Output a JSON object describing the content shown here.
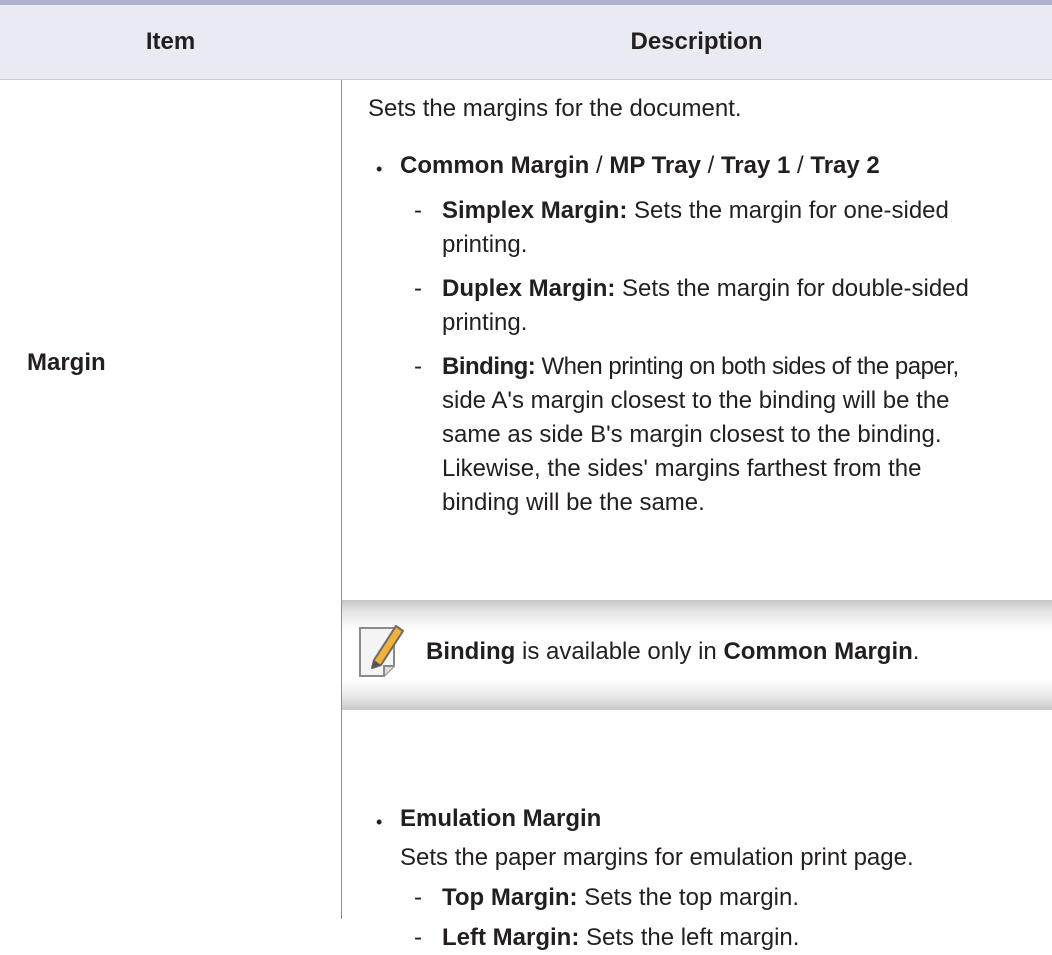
{
  "table": {
    "headers": {
      "item": "Item",
      "description": "Description"
    },
    "row": {
      "item": "Margin",
      "intro": "Sets the margins for the document.",
      "bullet1": {
        "common_margin": "Common Margin",
        "sep1": " / ",
        "mp_tray": "MP Tray",
        "sep2": " / ",
        "tray1": "Tray 1",
        "sep3": " / ",
        "tray2": "Tray 2"
      },
      "simplex": {
        "label": "Simplex Margin:",
        "line1": " Sets the margin for one-sided",
        "line2": "printing."
      },
      "duplex": {
        "label": "Duplex Margin:",
        "line1": " Sets the margin for double-sided",
        "line2": "printing."
      },
      "binding": {
        "label": "Binding:",
        "line1": " When printing on both sides of the paper,",
        "line2": "side A's margin closest to the binding will be the",
        "line3": "same as side B's margin closest to the binding.",
        "line4": "Likewise, the sides' margins farthest from the",
        "line5": "binding will be the same."
      },
      "note": {
        "binding": "Binding",
        "text": " is available only in ",
        "common_margin": "Common Margin",
        "period": "."
      },
      "emulation": {
        "title": "Emulation Margin",
        "desc": "Sets the paper margins for emulation print page.",
        "top": {
          "label": "Top Margin:",
          "text": " Sets the top margin."
        },
        "left": {
          "label": "Left Margin:",
          "text": " Sets the left margin."
        }
      },
      "bullet_char": "•",
      "dash_char": "-"
    }
  },
  "colors": {
    "header_bg": "#eaeaf3",
    "top_rule": "#b0b1d1",
    "text": "#231f20",
    "note_pencil": "#f2b233"
  },
  "icons": {
    "note": "note-pencil-icon"
  }
}
